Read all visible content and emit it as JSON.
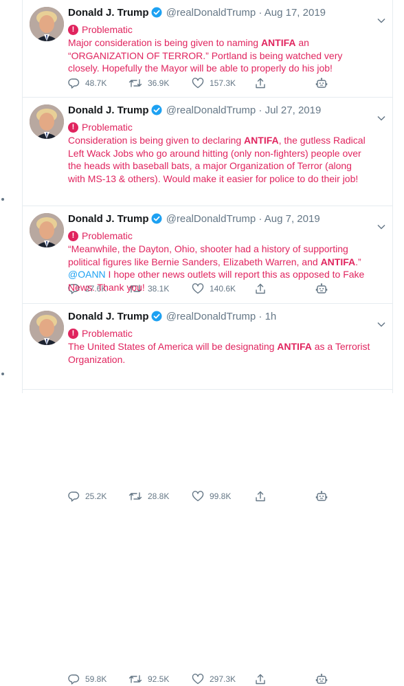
{
  "tweets": [
    {
      "name": "Donald J. Trump",
      "handle": "@realDonaldTrump",
      "sep": "·",
      "time": "Aug 17, 2019",
      "flag": "Problematic",
      "text_parts": [
        {
          "t": "Major consideration is being given to naming ",
          "s": "plain"
        },
        {
          "t": "ANTIFA",
          "s": "bold"
        },
        {
          "t": " an “ORGANIZATION OF TERROR.” Portland is being watched very closely. Hopefully the Mayor will be able to properly do his job!",
          "s": "plain"
        }
      ],
      "replies": "48.7K",
      "retweets": "36.9K",
      "likes": "157.3K"
    },
    {
      "name": "Donald J. Trump",
      "handle": "@realDonaldTrump",
      "sep": "·",
      "time": "Jul 27, 2019",
      "flag": "Problematic",
      "text_parts": [
        {
          "t": "Consideration is being given to declaring ",
          "s": "plain"
        },
        {
          "t": "ANTIFA",
          "s": "bold"
        },
        {
          "t": ", the gutless Radical Left Wack Jobs who go around hitting (only non-fighters) people over the heads with baseball bats, a major Organization of Terror (along with MS-13 & others). Would make it easier for police to do their job!",
          "s": "plain"
        }
      ],
      "replies": "27.6K",
      "retweets": "38.1K",
      "likes": "140.6K"
    },
    {
      "name": "Donald J. Trump",
      "handle": "@realDonaldTrump",
      "sep": "·",
      "time": "Aug 7, 2019",
      "flag": "Problematic",
      "text_parts": [
        {
          "t": "“Meanwhile, the Dayton, Ohio, shooter had a history of supporting political figures like Bernie Sanders, Elizabeth Warren, and ",
          "s": "plain"
        },
        {
          "t": "ANTIFA",
          "s": "bold"
        },
        {
          "t": ".” ",
          "s": "plain"
        },
        {
          "t": "@OANN",
          "s": "mention"
        },
        {
          "t": "  I hope other news outlets will report this as opposed to Fake News. Thank you!",
          "s": "plain"
        }
      ],
      "replies": "25.2K",
      "retweets": "28.8K",
      "likes": "99.8K"
    },
    {
      "name": "Donald J. Trump",
      "handle": "@realDonaldTrump",
      "sep": "·",
      "time": "1h",
      "flag": "Problematic",
      "text_parts": [
        {
          "t": "The United States of America will be designating ",
          "s": "plain"
        },
        {
          "t": "ANTIFA",
          "s": "bold"
        },
        {
          "t": " as a Terrorist Organization.",
          "s": "plain"
        }
      ],
      "replies": "59.8K",
      "retweets": "92.5K",
      "likes": "297.3K"
    }
  ],
  "colors": {
    "flag": "#e0245e",
    "mention": "#1da1f2",
    "muted": "#657786",
    "verified": "#1da1f2"
  },
  "icons": [
    "verified-badge-icon",
    "caret-down-icon",
    "reply-icon",
    "retweet-icon",
    "like-icon",
    "share-icon",
    "bot-icon",
    "warning-icon"
  ]
}
